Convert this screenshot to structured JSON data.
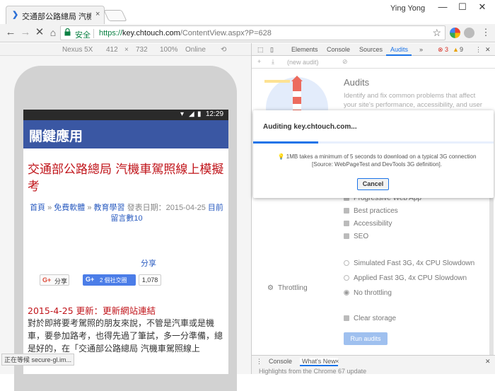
{
  "browser": {
    "tab_title": "交通部公路總局 汽機車駕照",
    "tab_close": "×",
    "user_name": "Ying Yong",
    "window_minimize": "—",
    "window_maximize": "☐",
    "window_close": "✕",
    "secure_label": "安全",
    "url_scheme": "https://",
    "url_host": "key.chtouch.com",
    "url_path": "/ContentView.aspx?P=628"
  },
  "device_toolbar": {
    "device": "Nexus 5X",
    "width": "412",
    "times": "×",
    "height": "732",
    "zoom": "100%",
    "network": "Online"
  },
  "phone": {
    "time": "12:29",
    "app_title": "關鍵應用",
    "article_title": "交通部公路總局 汽機車駕照線上模擬考",
    "breadcrumb_home": "首頁",
    "breadcrumb_sep1": " » ",
    "breadcrumb_cat": "免費軟體",
    "breadcrumb_sep2": " » ",
    "breadcrumb_sub": "教育學習",
    "publish_label": " 發表日期：2015-04-25 ",
    "comment_link": "目前留言數10",
    "share_link": "分享",
    "gplus_share": "分享",
    "gplus_count_btn": "2 個社交圈",
    "gplus_count": "1,078",
    "update_date": "2015-4-25 更新：",
    "update_link": "更新網站連結",
    "body_text": "對於即將要考駕照的朋友來說，不管是汽車或是機車，要參加路考，也得先過了筆試，多一分準備，總是好的，在「交通部公路總局 汽機車駕照線上",
    "status_tip": "正在等候 secure-gl.im..."
  },
  "devtools": {
    "tabs": [
      "Elements",
      "Console",
      "Sources",
      "Audits"
    ],
    "more": "»",
    "errors": "3",
    "warnings": "9",
    "audit_select": "(new audit)",
    "audits_title": "Audits",
    "audits_desc": "Identify and fix common problems that affect your site's performance, accessibility, and user",
    "categories": [
      "Progressive Web App",
      "Best practices",
      "Accessibility",
      "SEO"
    ],
    "throttling_label": "Throttling",
    "throttling_options": [
      "Simulated Fast 3G, 4x CPU Slowdown",
      "Applied Fast 3G, 4x CPU Slowdown",
      "No throttling"
    ],
    "selected_throttling": "No throttling",
    "clear_storage": "Clear storage",
    "run_audits": "Run audits",
    "drawer_tabs": [
      "Console",
      "What's New"
    ],
    "drawer_close": "×",
    "drawer_hint": "Highlights from the Chrome 67 update"
  },
  "modal": {
    "title": "Auditing key.chtouch.com...",
    "progress": 0.27,
    "message": "1MB takes a minimum of 5 seconds to download on a typical 3G connection [Source: WebPageTest and DevTools 3G definition].",
    "cancel": "Cancel"
  },
  "colors": {
    "accent": "#1a73e8",
    "app_bar": "#3a57a3",
    "article_red": "#c0141a",
    "secure_green": "#0b8043"
  }
}
